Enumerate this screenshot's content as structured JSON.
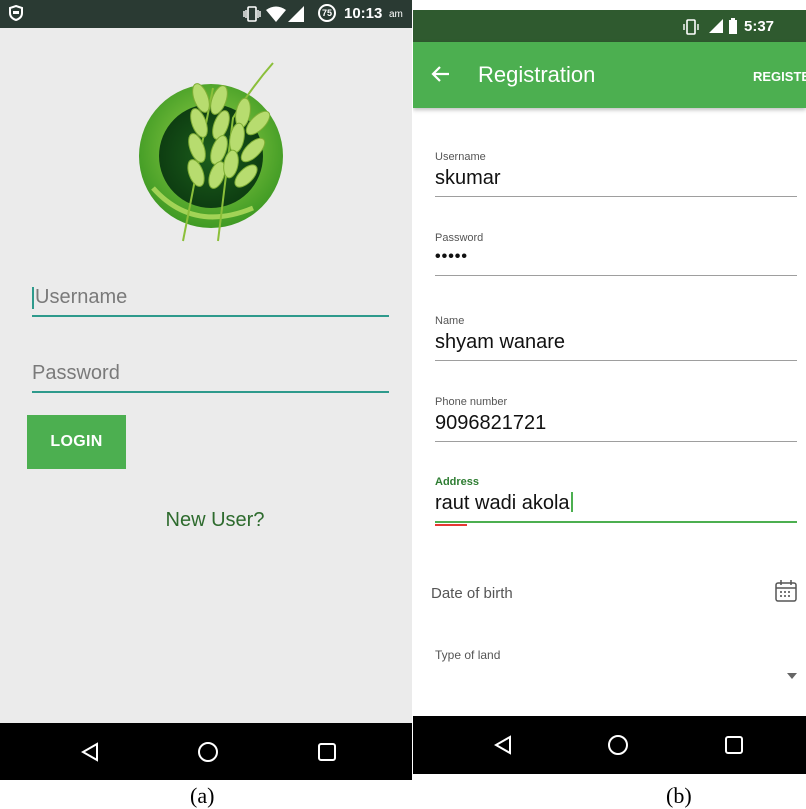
{
  "screen_a": {
    "status": {
      "time": "10:13",
      "ampm": "am",
      "notif_count": "75"
    },
    "username_placeholder": "Username",
    "password_placeholder": "Password",
    "login_label": "LOGIN",
    "new_user_label": "New User?",
    "caption": "(a)"
  },
  "screen_b": {
    "status": {
      "time": "5:37"
    },
    "title": "Registration",
    "register_label": "REGISTER",
    "fields": [
      {
        "label": "Username",
        "value": "skumar"
      },
      {
        "label": "Password",
        "value": "•••••"
      },
      {
        "label": "Name",
        "value": "shyam wanare"
      },
      {
        "label": "Phone number",
        "value": "9096821721"
      },
      {
        "label": "Address",
        "value": "raut wadi akola"
      }
    ],
    "dob_label": "Date of birth",
    "land_label": "Type of land",
    "caption": "(b)"
  },
  "colors": {
    "accent": "#4caf50",
    "teal_underline": "#2e9a8c",
    "dark_green_text": "#2e6b2e"
  }
}
